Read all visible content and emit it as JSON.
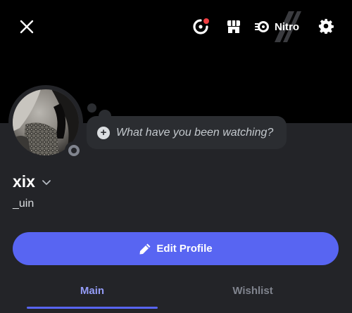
{
  "topbar": {
    "close_icon": "close-icon",
    "activity_icon": "activity-icon",
    "activity_badge_color": "#f23f43",
    "shop_icon": "shop-icon",
    "nitro_label": "Nitro",
    "settings_icon": "gear-icon"
  },
  "profile": {
    "display_name": "xix",
    "username": "_uin",
    "status_prompt": "What have you been watching?",
    "status_color": "#80848e"
  },
  "actions": {
    "edit_profile_label": "Edit Profile"
  },
  "tabs": [
    {
      "label": "Main",
      "active": true
    },
    {
      "label": "Wishlist",
      "active": false
    }
  ],
  "theme": {
    "accent": "#5865f2",
    "active_tab": "#949cf7",
    "panel_bg": "#232428"
  }
}
